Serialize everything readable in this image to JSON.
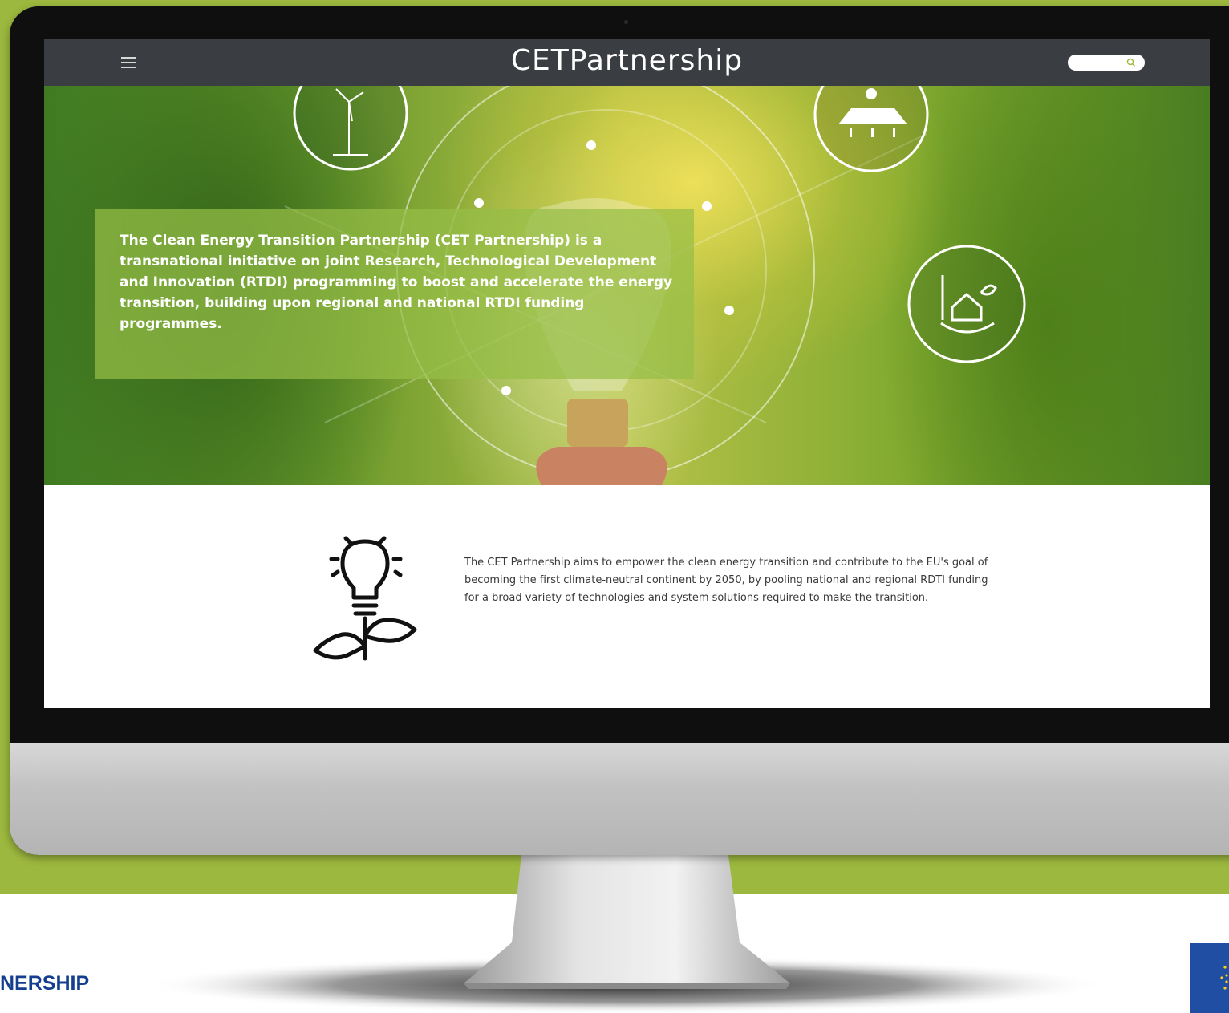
{
  "site": {
    "title": "CETPartnership",
    "search_placeholder": ""
  },
  "hero": {
    "text": "The Clean Energy Transition Partnership (CET Partnership) is a transnational initiative on joint Research, Technological Development and Innovation (RTDI) programming to boost and accelerate the energy transition, building upon regional and national RTDI funding programmes."
  },
  "content": {
    "body": "The CET Partnership aims to empower the clean energy transition and contribute to the EU's goal of becoming the first climate-neutral continent by 2050, by pooling national and regional RDTI funding for a broad variety of technologies and system solutions required to make the transition."
  },
  "footer": {
    "label": "NERSHIP"
  },
  "icons": [
    "menu-icon",
    "search-icon",
    "wind-turbine-icon",
    "solar-panel-icon",
    "green-house-hand-icon",
    "light-bulb-icon",
    "bulb-plant-icon",
    "eu-flag-icon"
  ],
  "colors": {
    "background_green": "#9cb83e",
    "navbar": "#3a3d41",
    "hero_box": "#96be46",
    "footer_text": "#143f8f",
    "eu_blue": "#1f4ea3"
  }
}
